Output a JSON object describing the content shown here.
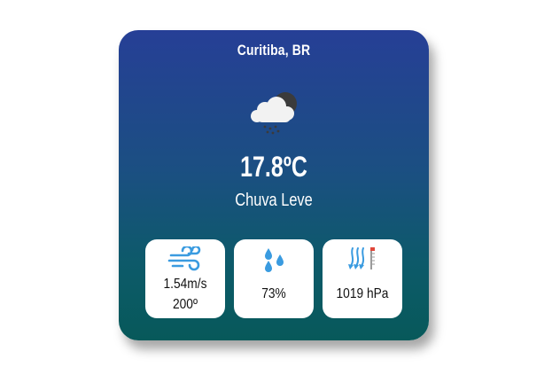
{
  "location": "Curitiba, BR",
  "condition_icon": "cloud-rain-night-icon",
  "temperature": "17.8ºC",
  "description": "Chuva Leve",
  "colors": {
    "card_top": "#263f96",
    "card_bottom": "#07595a",
    "icon_accent": "#3a9be0"
  },
  "metrics": {
    "wind": {
      "icon": "wind-icon",
      "speed": "1.54m/s",
      "direction": "200º"
    },
    "humidity": {
      "icon": "humidity-drops-icon",
      "value": "73%"
    },
    "pressure": {
      "icon": "pressure-icon",
      "value": "1019 hPa"
    }
  }
}
